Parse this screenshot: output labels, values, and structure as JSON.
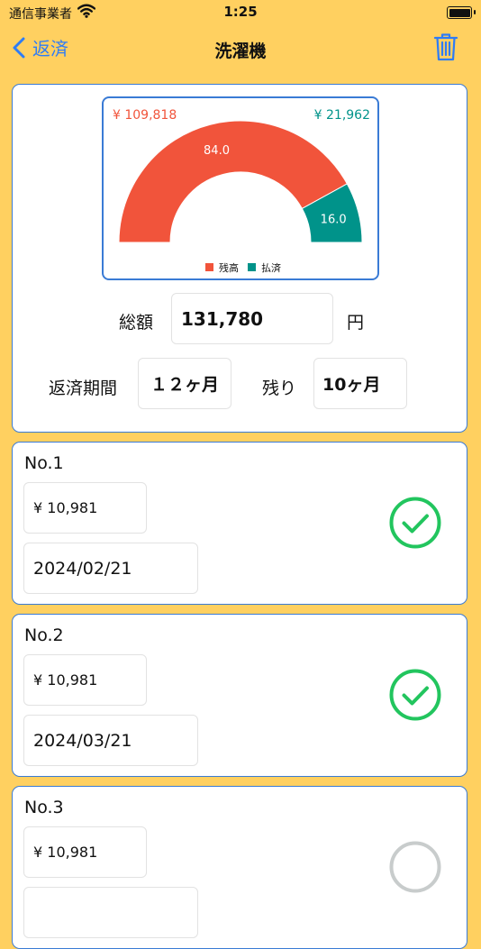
{
  "status_bar": {
    "carrier": "通信事業者",
    "time": "1:25"
  },
  "nav": {
    "back_label": "返済",
    "title": "洗濯機"
  },
  "colors": {
    "background": "#FFD060",
    "remaining": "#F1543B",
    "paid": "#00938A",
    "accent": "#2E7CF6",
    "check": "#22C55E"
  },
  "summary": {
    "chart_data": {
      "type": "pie",
      "shape": "half-donut",
      "remaining_amount_label": "¥ 109,818",
      "paid_amount_label": "¥ 21,962",
      "slices": [
        {
          "label": "残高",
          "value": 84.0,
          "display": "84.0"
        },
        {
          "label": "払済",
          "value": 16.0,
          "display": "16.0"
        }
      ],
      "legend_position": "bottom"
    },
    "total_label": "総額",
    "total_value": "131,780",
    "total_unit": "円",
    "period_label": "返済期間",
    "period_value": "１２ヶ月",
    "remaining_label": "残り",
    "remaining_value": "10ヶ月"
  },
  "payments": [
    {
      "title": "No.1",
      "amount": "¥ 10,981",
      "date": "2024/02/21",
      "paid": true
    },
    {
      "title": "No.2",
      "amount": "¥ 10,981",
      "date": "2024/03/21",
      "paid": true
    },
    {
      "title": "No.3",
      "amount": "¥ 10,981",
      "date": "",
      "paid": false
    }
  ],
  "icons": {
    "back": "chevron-left-icon",
    "trash": "trash-icon",
    "check": "checkmark-circle-icon",
    "wifi": "wifi-icon",
    "battery": "battery-icon"
  }
}
